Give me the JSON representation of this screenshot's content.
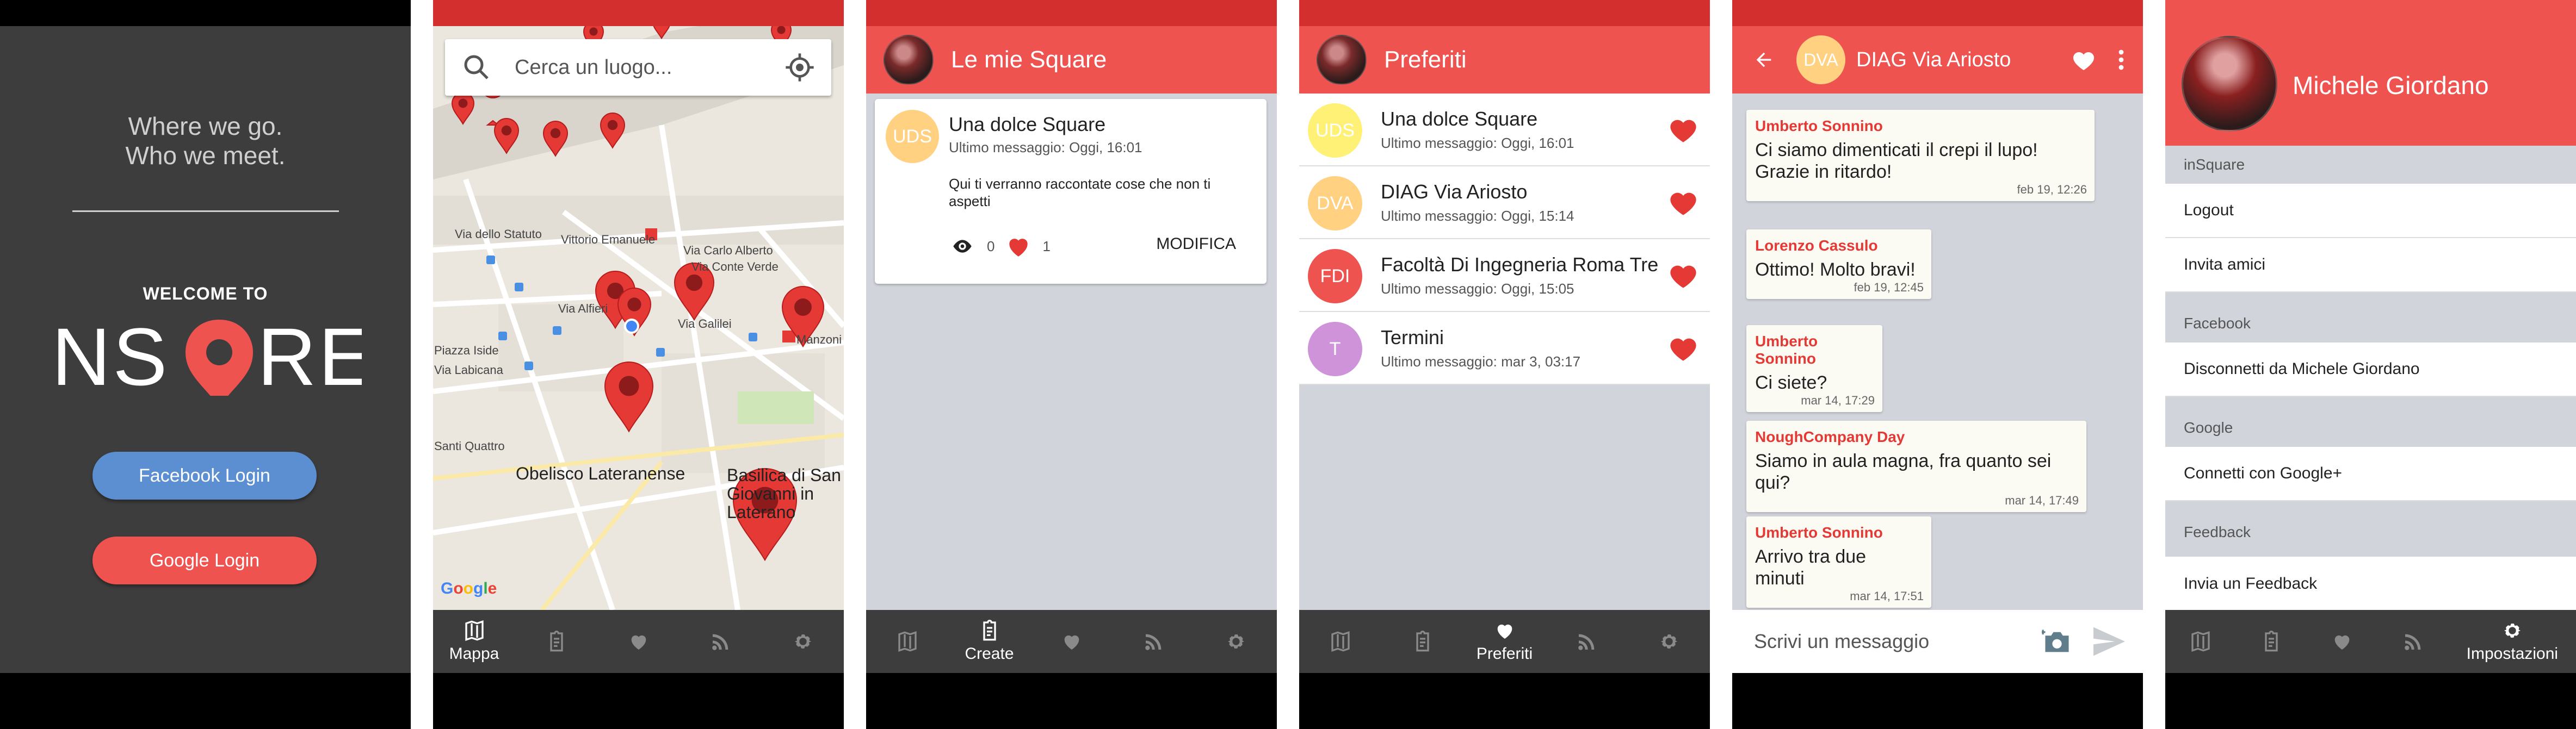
{
  "colors": {
    "primary": "#ef5350",
    "status": "#d32f2f",
    "dark": "#3d3d3d",
    "facebook": "#5b8fd1",
    "content_bg": "#d1d5db"
  },
  "welcome": {
    "tagline_line1": "Where we go.",
    "tagline_line2": "Who we meet.",
    "welcome_to": "WELCOME TO",
    "logo_text": "NSQRE",
    "facebook_login": "Facebook Login",
    "google_login": "Google Login"
  },
  "map": {
    "search_placeholder": "Cerca un luogo...",
    "labels": [
      "Vittorio Emanuele",
      "Via dello Statuto",
      "Via Carlo Alberto",
      "Via Conte Verde",
      "Via Alfieri",
      "Via Galilei",
      "Piazza Iside",
      "Via Labicana",
      "Manzoni",
      "Santi Quattro",
      "Obelisco Lateranense",
      "Basilica di San Giovanni in Laterano"
    ],
    "attribution": "Google"
  },
  "tabs": {
    "map": "Mappa",
    "create": "Create",
    "favorites": "Preferiti",
    "settings": "Impostazioni"
  },
  "my_squares": {
    "title": "Le mie Square",
    "card": {
      "initials": "UDS",
      "name": "Una dolce Square",
      "last_message": "Ultimo messaggio: Oggi, 16:01",
      "description": "Qui ti verranno raccontate cose che non ti aspetti",
      "views": "0",
      "likes": "1",
      "edit": "MODIFICA"
    }
  },
  "favorites": {
    "title": "Preferiti",
    "items": [
      {
        "initials": "UDS",
        "name": "Una dolce Square",
        "last": "Ultimo messaggio: Oggi, 16:01",
        "color": "#fff176"
      },
      {
        "initials": "DVA",
        "name": "DIAG Via Ariosto",
        "last": "Ultimo messaggio: Oggi, 15:14",
        "color": "#ffd180"
      },
      {
        "initials": "FDI",
        "name": "Facoltà Di Ingegneria Roma Tre",
        "last": "Ultimo messaggio: Oggi, 15:05",
        "color": "#ef5350"
      },
      {
        "initials": "T",
        "name": "Termini",
        "last": "Ultimo messaggio: mar 3, 03:17",
        "color": "#ce93d8"
      }
    ]
  },
  "chat": {
    "initials": "DVA",
    "title": "DIAG Via Ariosto",
    "input_placeholder": "Scrivi un messaggio",
    "messages": [
      {
        "name": "Umberto Sonnino",
        "text": "Ci siamo dimenticati il crepi il lupo! Grazie in ritardo!",
        "time": "feb 19, 12:26"
      },
      {
        "name": "Lorenzo Cassulo",
        "text": "Ottimo! Molto bravi!",
        "time": "feb 19, 12:45"
      },
      {
        "name": "Umberto Sonnino",
        "text": "Ci siete?",
        "time": "mar 14, 17:29"
      },
      {
        "name": "NoughCompany Day",
        "text": "Siamo in aula magna, fra quanto sei qui?",
        "time": "mar 14, 17:49"
      },
      {
        "name": "Umberto Sonnino",
        "text": "Arrivo tra due minuti",
        "time": "mar 14, 17:51"
      }
    ]
  },
  "drawer": {
    "user_name": "Michele Giordano",
    "sections": {
      "insquare": "inSquare",
      "facebook": "Facebook",
      "google": "Google",
      "feedback": "Feedback"
    },
    "items": {
      "logout": "Logout",
      "invite": "Invita amici",
      "fb_disconnect": "Disconnetti da Michele Giordano",
      "google_connect": "Connetti con Google+",
      "send_feedback": "Invia un Feedback"
    }
  }
}
